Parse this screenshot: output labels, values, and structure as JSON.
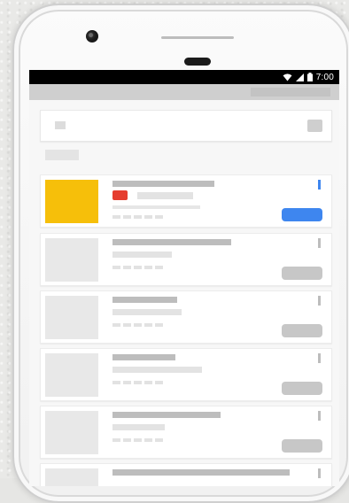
{
  "status_bar": {
    "time": "7:00",
    "icons": [
      "wifi-icon",
      "signal-icon",
      "battery-icon"
    ]
  },
  "colors": {
    "accent": "#3e86ef",
    "thumbnail_active": "#f6bf0a",
    "badge": "#e53d2f",
    "placeholder": "#e8e8e8"
  },
  "list": {
    "items": [
      {
        "state": "active"
      },
      {
        "state": "placeholder"
      },
      {
        "state": "placeholder"
      },
      {
        "state": "placeholder"
      },
      {
        "state": "placeholder"
      },
      {
        "state": "placeholder"
      }
    ]
  }
}
